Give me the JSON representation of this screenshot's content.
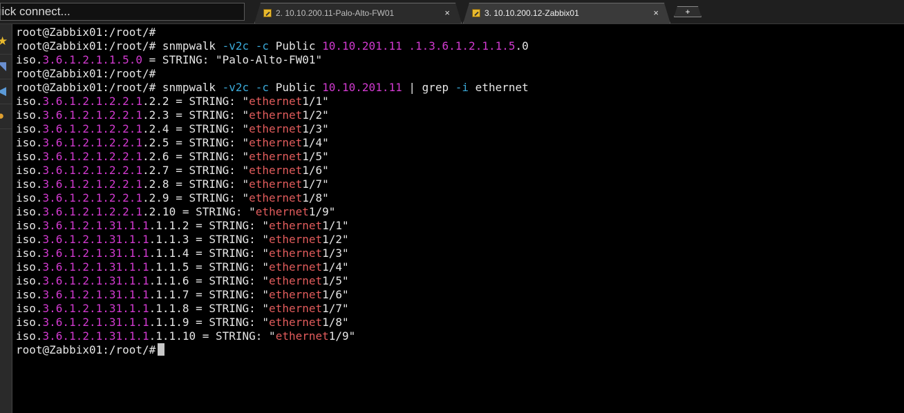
{
  "topbar": {
    "quick_connect_placeholder": "uick connect...",
    "tabs": [
      {
        "label": "2. 10.10.200.11-Palo-Alto-FW01",
        "close": "×",
        "active": false
      },
      {
        "label": "3. 10.10.200.12-Zabbix01",
        "close": "×",
        "active": true
      }
    ],
    "new_tab": "+"
  },
  "sidebar": {
    "icons": [
      "star-icon",
      "arrow-icon",
      "paper-plane-icon",
      "macro-icon"
    ]
  },
  "terminal": {
    "prompt": "root@Zabbix01:/root/# ",
    "lines": [
      {
        "segments": [
          {
            "text": "root@Zabbix01:/root/# ",
            "c": ""
          }
        ]
      },
      {
        "segments": [
          {
            "text": "root@Zabbix01:/root/# snmpwalk ",
            "c": ""
          },
          {
            "text": "-v2c",
            "c": "cyan"
          },
          {
            "text": " ",
            "c": ""
          },
          {
            "text": "-c",
            "c": "cyan"
          },
          {
            "text": " Public ",
            "c": ""
          },
          {
            "text": "10.10.201.11",
            "c": "mag"
          },
          {
            "text": " ",
            "c": ""
          },
          {
            "text": ".1.3.6.1.2.1.1.5",
            "c": "mag"
          },
          {
            "text": ".0",
            "c": ""
          }
        ]
      },
      {
        "segments": [
          {
            "text": "iso.",
            "c": ""
          },
          {
            "text": "3.6.1.2.1.1.5.0",
            "c": "mag"
          },
          {
            "text": " = STRING: \"Palo-Alto-FW01\"",
            "c": ""
          }
        ]
      },
      {
        "segments": [
          {
            "text": "root@Zabbix01:/root/# ",
            "c": ""
          }
        ]
      },
      {
        "segments": [
          {
            "text": "root@Zabbix01:/root/# snmpwalk ",
            "c": ""
          },
          {
            "text": "-v2c",
            "c": "cyan"
          },
          {
            "text": " ",
            "c": ""
          },
          {
            "text": "-c",
            "c": "cyan"
          },
          {
            "text": " Public ",
            "c": ""
          },
          {
            "text": "10.10.201.11",
            "c": "mag"
          },
          {
            "text": " | grep ",
            "c": ""
          },
          {
            "text": "-i",
            "c": "cyan"
          },
          {
            "text": " ethernet",
            "c": ""
          }
        ]
      },
      {
        "segments": [
          {
            "text": "iso.",
            "c": ""
          },
          {
            "text": "3.6.1.2.1.2.2.1",
            "c": "mag"
          },
          {
            "text": ".2.2 = STRING: \"",
            "c": ""
          },
          {
            "text": "ethernet",
            "c": "red"
          },
          {
            "text": "1/1\"",
            "c": ""
          }
        ]
      },
      {
        "segments": [
          {
            "text": "iso.",
            "c": ""
          },
          {
            "text": "3.6.1.2.1.2.2.1",
            "c": "mag"
          },
          {
            "text": ".2.3 = STRING: \"",
            "c": ""
          },
          {
            "text": "ethernet",
            "c": "red"
          },
          {
            "text": "1/2\"",
            "c": ""
          }
        ]
      },
      {
        "segments": [
          {
            "text": "iso.",
            "c": ""
          },
          {
            "text": "3.6.1.2.1.2.2.1",
            "c": "mag"
          },
          {
            "text": ".2.4 = STRING: \"",
            "c": ""
          },
          {
            "text": "ethernet",
            "c": "red"
          },
          {
            "text": "1/3\"",
            "c": ""
          }
        ]
      },
      {
        "segments": [
          {
            "text": "iso.",
            "c": ""
          },
          {
            "text": "3.6.1.2.1.2.2.1",
            "c": "mag"
          },
          {
            "text": ".2.5 = STRING: \"",
            "c": ""
          },
          {
            "text": "ethernet",
            "c": "red"
          },
          {
            "text": "1/4\"",
            "c": ""
          }
        ]
      },
      {
        "segments": [
          {
            "text": "iso.",
            "c": ""
          },
          {
            "text": "3.6.1.2.1.2.2.1",
            "c": "mag"
          },
          {
            "text": ".2.6 = STRING: \"",
            "c": ""
          },
          {
            "text": "ethernet",
            "c": "red"
          },
          {
            "text": "1/5\"",
            "c": ""
          }
        ]
      },
      {
        "segments": [
          {
            "text": "iso.",
            "c": ""
          },
          {
            "text": "3.6.1.2.1.2.2.1",
            "c": "mag"
          },
          {
            "text": ".2.7 = STRING: \"",
            "c": ""
          },
          {
            "text": "ethernet",
            "c": "red"
          },
          {
            "text": "1/6\"",
            "c": ""
          }
        ]
      },
      {
        "segments": [
          {
            "text": "iso.",
            "c": ""
          },
          {
            "text": "3.6.1.2.1.2.2.1",
            "c": "mag"
          },
          {
            "text": ".2.8 = STRING: \"",
            "c": ""
          },
          {
            "text": "ethernet",
            "c": "red"
          },
          {
            "text": "1/7\"",
            "c": ""
          }
        ]
      },
      {
        "segments": [
          {
            "text": "iso.",
            "c": ""
          },
          {
            "text": "3.6.1.2.1.2.2.1",
            "c": "mag"
          },
          {
            "text": ".2.9 = STRING: \"",
            "c": ""
          },
          {
            "text": "ethernet",
            "c": "red"
          },
          {
            "text": "1/8\"",
            "c": ""
          }
        ]
      },
      {
        "segments": [
          {
            "text": "iso.",
            "c": ""
          },
          {
            "text": "3.6.1.2.1.2.2.1",
            "c": "mag"
          },
          {
            "text": ".2.10 = STRING: \"",
            "c": ""
          },
          {
            "text": "ethernet",
            "c": "red"
          },
          {
            "text": "1/9\"",
            "c": ""
          }
        ]
      },
      {
        "segments": [
          {
            "text": "iso.",
            "c": ""
          },
          {
            "text": "3.6.1.2.1.31.1.1",
            "c": "mag"
          },
          {
            "text": ".1.1.2 = STRING: \"",
            "c": ""
          },
          {
            "text": "ethernet",
            "c": "red"
          },
          {
            "text": "1/1\"",
            "c": ""
          }
        ]
      },
      {
        "segments": [
          {
            "text": "iso.",
            "c": ""
          },
          {
            "text": "3.6.1.2.1.31.1.1",
            "c": "mag"
          },
          {
            "text": ".1.1.3 = STRING: \"",
            "c": ""
          },
          {
            "text": "ethernet",
            "c": "red"
          },
          {
            "text": "1/2\"",
            "c": ""
          }
        ]
      },
      {
        "segments": [
          {
            "text": "iso.",
            "c": ""
          },
          {
            "text": "3.6.1.2.1.31.1.1",
            "c": "mag"
          },
          {
            "text": ".1.1.4 = STRING: \"",
            "c": ""
          },
          {
            "text": "ethernet",
            "c": "red"
          },
          {
            "text": "1/3\"",
            "c": ""
          }
        ]
      },
      {
        "segments": [
          {
            "text": "iso.",
            "c": ""
          },
          {
            "text": "3.6.1.2.1.31.1.1",
            "c": "mag"
          },
          {
            "text": ".1.1.5 = STRING: \"",
            "c": ""
          },
          {
            "text": "ethernet",
            "c": "red"
          },
          {
            "text": "1/4\"",
            "c": ""
          }
        ]
      },
      {
        "segments": [
          {
            "text": "iso.",
            "c": ""
          },
          {
            "text": "3.6.1.2.1.31.1.1",
            "c": "mag"
          },
          {
            "text": ".1.1.6 = STRING: \"",
            "c": ""
          },
          {
            "text": "ethernet",
            "c": "red"
          },
          {
            "text": "1/5\"",
            "c": ""
          }
        ]
      },
      {
        "segments": [
          {
            "text": "iso.",
            "c": ""
          },
          {
            "text": "3.6.1.2.1.31.1.1",
            "c": "mag"
          },
          {
            "text": ".1.1.7 = STRING: \"",
            "c": ""
          },
          {
            "text": "ethernet",
            "c": "red"
          },
          {
            "text": "1/6\"",
            "c": ""
          }
        ]
      },
      {
        "segments": [
          {
            "text": "iso.",
            "c": ""
          },
          {
            "text": "3.6.1.2.1.31.1.1",
            "c": "mag"
          },
          {
            "text": ".1.1.8 = STRING: \"",
            "c": ""
          },
          {
            "text": "ethernet",
            "c": "red"
          },
          {
            "text": "1/7\"",
            "c": ""
          }
        ]
      },
      {
        "segments": [
          {
            "text": "iso.",
            "c": ""
          },
          {
            "text": "3.6.1.2.1.31.1.1",
            "c": "mag"
          },
          {
            "text": ".1.1.9 = STRING: \"",
            "c": ""
          },
          {
            "text": "ethernet",
            "c": "red"
          },
          {
            "text": "1/8\"",
            "c": ""
          }
        ]
      },
      {
        "segments": [
          {
            "text": "iso.",
            "c": ""
          },
          {
            "text": "3.6.1.2.1.31.1.1",
            "c": "mag"
          },
          {
            "text": ".1.1.10 = STRING: \"",
            "c": ""
          },
          {
            "text": "ethernet",
            "c": "red"
          },
          {
            "text": "1/9\"",
            "c": ""
          }
        ]
      }
    ]
  },
  "colors": {
    "background": "#000000",
    "text": "#e6e6e6",
    "magenta": "#d23ad0",
    "cyan": "#3aa9d8",
    "red": "#e25c5c"
  }
}
